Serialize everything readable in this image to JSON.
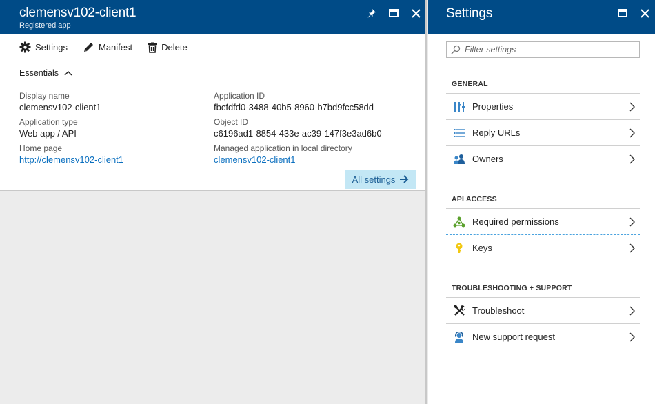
{
  "left_blade": {
    "title": "clemensv102-client1",
    "subtitle": "Registered app",
    "commands": [
      {
        "label": "Settings",
        "icon": "gear-icon"
      },
      {
        "label": "Manifest",
        "icon": "pencil-icon"
      },
      {
        "label": "Delete",
        "icon": "trash-icon"
      }
    ],
    "essentials_label": "Essentials",
    "fields": {
      "display_name": {
        "label": "Display name",
        "value": "clemensv102-client1"
      },
      "application_type": {
        "label": "Application type",
        "value": "Web app / API"
      },
      "home_page": {
        "label": "Home page",
        "value": "http://clemensv102-client1"
      },
      "application_id": {
        "label": "Application ID",
        "value": "fbcfdfd0-3488-40b5-8960-b7bd9fcc58dd"
      },
      "object_id": {
        "label": "Object ID",
        "value": "c6196ad1-8854-433e-ac39-147f3e3ad6b0"
      },
      "managed_app": {
        "label": "Managed application in local directory",
        "value": "clemensv102-client1"
      }
    },
    "all_settings_label": "All settings"
  },
  "right_blade": {
    "title": "Settings",
    "filter_placeholder": "Filter settings",
    "sections": [
      {
        "heading": "GENERAL",
        "items": [
          {
            "label": "Properties",
            "icon": "properties-icon"
          },
          {
            "label": "Reply URLs",
            "icon": "list-icon"
          },
          {
            "label": "Owners",
            "icon": "owners-icon"
          }
        ]
      },
      {
        "heading": "API ACCESS",
        "items": [
          {
            "label": "Required permissions",
            "icon": "permissions-icon"
          },
          {
            "label": "Keys",
            "icon": "key-icon"
          }
        ]
      },
      {
        "heading": "TROUBLESHOOTING + SUPPORT",
        "items": [
          {
            "label": "Troubleshoot",
            "icon": "tools-icon"
          },
          {
            "label": "New support request",
            "icon": "support-icon"
          }
        ]
      }
    ]
  },
  "colors": {
    "header": "#004b87",
    "link": "#0a6fbf",
    "accent_button": "#c3e7f5"
  }
}
